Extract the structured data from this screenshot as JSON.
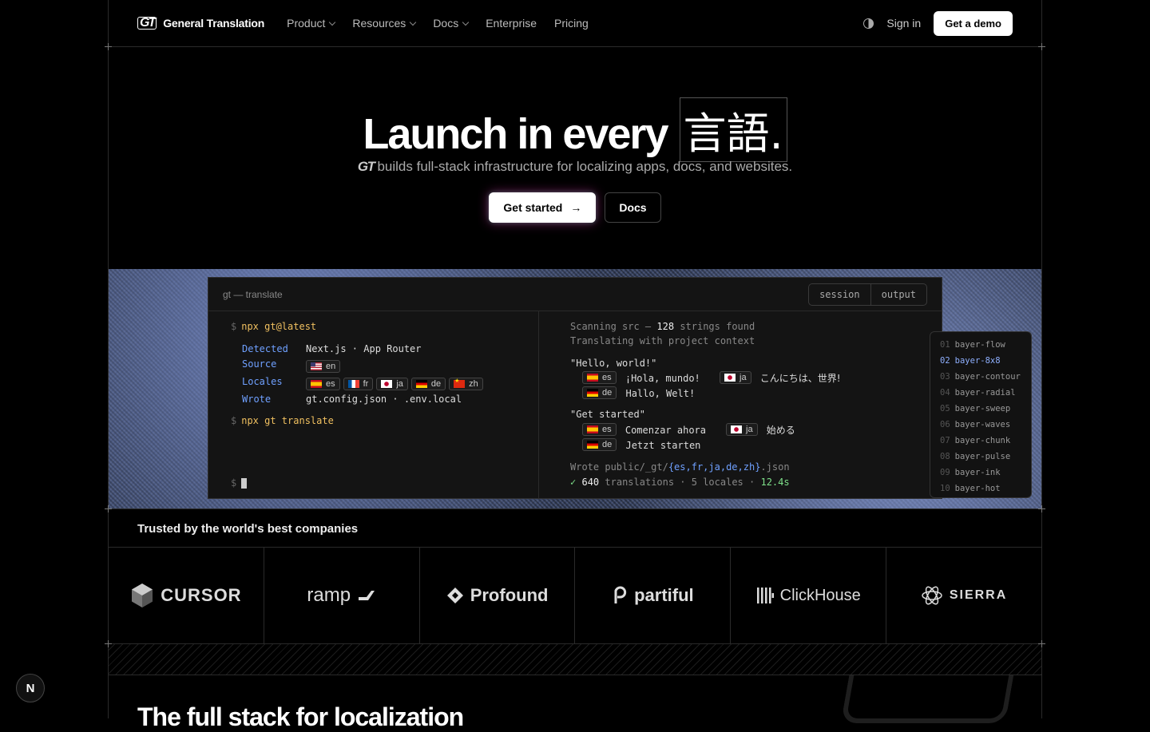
{
  "header": {
    "brand": "General Translation",
    "brand_mark": "GT",
    "nav": [
      {
        "label": "Product",
        "dropdown": true
      },
      {
        "label": "Resources",
        "dropdown": true
      },
      {
        "label": "Docs",
        "dropdown": true
      },
      {
        "label": "Enterprise",
        "dropdown": false
      },
      {
        "label": "Pricing",
        "dropdown": false
      }
    ],
    "sign_in": "Sign in",
    "demo": "Get a demo"
  },
  "hero": {
    "title": "Launch in every",
    "title_word": "言語.",
    "subtitle_mark": "GT",
    "subtitle": "builds full-stack infrastructure for localizing apps, docs, and websites.",
    "primary_cta": "Get started",
    "secondary_cta": "Docs"
  },
  "terminal": {
    "title": "gt — translate",
    "tabs": [
      "session",
      "output"
    ],
    "prompt": "$",
    "cmd1": "npx gt@latest",
    "detected_label": "Detected",
    "detected_value": "Next.js · App Router",
    "source_label": "Source",
    "source_locale": "en",
    "locales_label": "Locales",
    "locales": [
      "es",
      "fr",
      "ja",
      "de",
      "zh"
    ],
    "wrote_label": "Wrote",
    "wrote_value": "gt.config.json · .env.local",
    "cmd2": "npx gt translate",
    "scan_prefix": "Scanning src —",
    "scan_count": "128",
    "scan_suffix": "strings found",
    "context_line": "Translating with project context",
    "group1_src": "\"Hello, world!\"",
    "group1": {
      "es": "¡Hola, mundo!",
      "ja": "こんにちは、世界!",
      "de": "Hallo, Welt!"
    },
    "group2_src": "\"Get started\"",
    "group2": {
      "es": "Comenzar ahora",
      "ja": "始める",
      "de": "Jetzt starten"
    },
    "wrote_out_prefix": "Wrote public/_gt/",
    "wrote_out_set": "{es,fr,ja,de,zh}",
    "wrote_out_suffix": ".json",
    "done_check": "✓",
    "done_count": "640",
    "done_mid": "translations · 5 locales ·",
    "done_time": "12.4s"
  },
  "presets": [
    {
      "num": "01",
      "name": "bayer-flow"
    },
    {
      "num": "02",
      "name": "bayer-8x8",
      "active": true
    },
    {
      "num": "03",
      "name": "bayer-contour"
    },
    {
      "num": "04",
      "name": "bayer-radial"
    },
    {
      "num": "05",
      "name": "bayer-sweep"
    },
    {
      "num": "06",
      "name": "bayer-waves"
    },
    {
      "num": "07",
      "name": "bayer-chunk"
    },
    {
      "num": "08",
      "name": "bayer-pulse"
    },
    {
      "num": "09",
      "name": "bayer-ink"
    },
    {
      "num": "10",
      "name": "bayer-hot"
    }
  ],
  "trusted": {
    "heading": "Trusted by the world's best companies",
    "logos": [
      "CURSOR",
      "ramp",
      "Profound",
      "partiful",
      "ClickHouse",
      "SIERRA"
    ]
  },
  "next_section_title": "The full stack for localization",
  "badge": "N",
  "colors": {
    "accent_blue": "#6fa0ff",
    "command": "#f0c060",
    "success": "#7ee08a"
  }
}
